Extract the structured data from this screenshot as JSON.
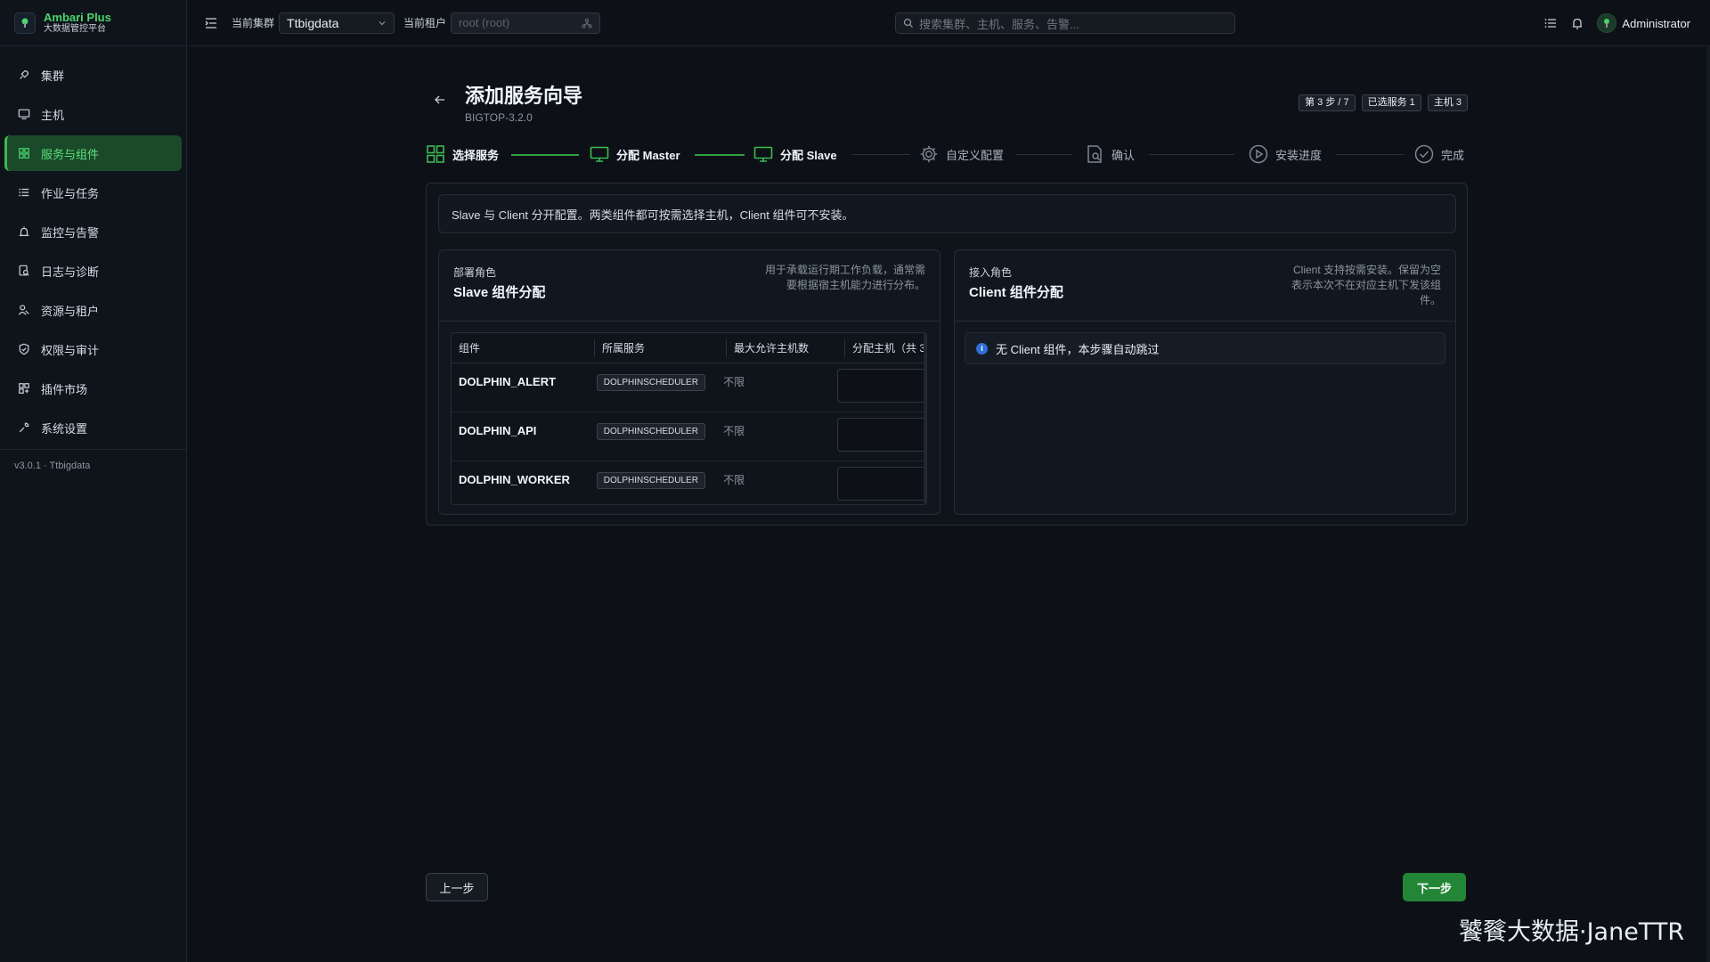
{
  "brand": {
    "title": "Ambari Plus",
    "subtitle": "大数据管控平台"
  },
  "sidebar": {
    "items": [
      {
        "label": "集群",
        "icon": "rocket-icon",
        "active": false
      },
      {
        "label": "主机",
        "icon": "monitor-icon",
        "active": false
      },
      {
        "label": "服务与组件",
        "icon": "grid-icon",
        "active": true
      },
      {
        "label": "作业与任务",
        "icon": "list-icon",
        "active": false
      },
      {
        "label": "监控与告警",
        "icon": "alarm-icon",
        "active": false
      },
      {
        "label": "日志与诊断",
        "icon": "log-search-icon",
        "active": false
      },
      {
        "label": "资源与租户",
        "icon": "users-icon",
        "active": false
      },
      {
        "label": "权限与审计",
        "icon": "shield-icon",
        "active": false
      },
      {
        "label": "插件市场",
        "icon": "plugin-icon",
        "active": false
      },
      {
        "label": "系统设置",
        "icon": "wrench-icon",
        "active": false
      }
    ],
    "version": "v3.0.1 · Ttbigdata"
  },
  "topbar": {
    "cluster_label": "当前集群",
    "cluster_value": "Ttbigdata",
    "tenant_label": "当前租户",
    "tenant_placeholder": "root (root)",
    "search_placeholder": "搜索集群、主机、服务、告警...",
    "username": "Administrator"
  },
  "wizard": {
    "title": "添加服务向导",
    "subtitle": "BIGTOP-3.2.0",
    "chips": [
      "第 3 步 / 7",
      "已选服务 1",
      "主机 3"
    ],
    "steps": [
      {
        "label": "选择服务",
        "state": "done",
        "icon": "grid-icon"
      },
      {
        "label": "分配 Master",
        "state": "done",
        "icon": "monitor-icon"
      },
      {
        "label": "分配 Slave",
        "state": "done",
        "icon": "monitor-icon"
      },
      {
        "label": "自定义配置",
        "state": "todo",
        "icon": "gear-icon"
      },
      {
        "label": "确认",
        "state": "todo",
        "icon": "doc-search-icon"
      },
      {
        "label": "安装进度",
        "state": "todo",
        "icon": "play-circle-icon"
      },
      {
        "label": "完成",
        "state": "todo",
        "icon": "check-circle-icon"
      }
    ],
    "info": "Slave 与 Client 分开配置。两类组件都可按需选择主机，Client 组件可不安装。",
    "slave": {
      "kicker": "部署角色",
      "title": "Slave 组件分配",
      "desc": "用于承载运行期工作负载，通常需要根据宿主机能力进行分布。",
      "columns": [
        "组件",
        "所属服务",
        "最大允许主机数",
        "分配主机（共 3"
      ],
      "rows": [
        {
          "component": "DOLPHIN_ALERT",
          "service": "DOLPHINSCHEDULER",
          "max": "不限"
        },
        {
          "component": "DOLPHIN_API",
          "service": "DOLPHINSCHEDULER",
          "max": "不限"
        },
        {
          "component": "DOLPHIN_WORKER",
          "service": "DOLPHINSCHEDULER",
          "max": "不限"
        }
      ]
    },
    "client": {
      "kicker": "接入角色",
      "title": "Client 组件分配",
      "desc": "Client 支持按需安装。保留为空表示本次不在对应主机下发该组件。",
      "empty": "无 Client 组件，本步骤自动跳过"
    },
    "prev_label": "上一步",
    "next_label": "下一步"
  },
  "watermark": "饕餮大数据·JaneTTR",
  "colors": {
    "accent": "#3fb950",
    "primary_button": "#238636",
    "info_dot": "#2f6fd6"
  }
}
